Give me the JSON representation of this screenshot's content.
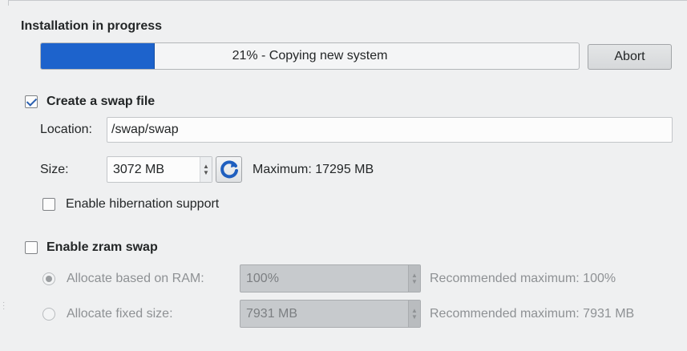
{
  "installation": {
    "title": "Installation in progress",
    "progress_value": 21,
    "progress_text": "21% - Copying new system",
    "abort_label": "Abort"
  },
  "swap_file": {
    "checkbox_label": "Create a swap file",
    "checked": true,
    "location_label": "Location:",
    "location_value": "/swap/swap",
    "size_label": "Size:",
    "size_value": "3072 MB",
    "maximum_text": "Maximum: 17295 MB",
    "hibernation_label": "Enable hibernation support",
    "hibernation_checked": false
  },
  "zram": {
    "checkbox_label": "Enable zram swap",
    "checked": false,
    "ram_option_label": "Allocate based on RAM:",
    "ram_value": "100%",
    "ram_recommended": "Recommended maximum: 100%",
    "fixed_option_label": "Allocate fixed size:",
    "fixed_value": "7931 MB",
    "fixed_recommended": "Recommended maximum: 7931 MB"
  },
  "colors": {
    "progress_fill": "#1d63cc",
    "check_accent": "#2a5fb0",
    "refresh_icon": "#1f5fbf"
  },
  "icons": {
    "refresh": "refresh-icon",
    "check": "check-icon",
    "spin_arrows": "spin-arrows-icon"
  }
}
